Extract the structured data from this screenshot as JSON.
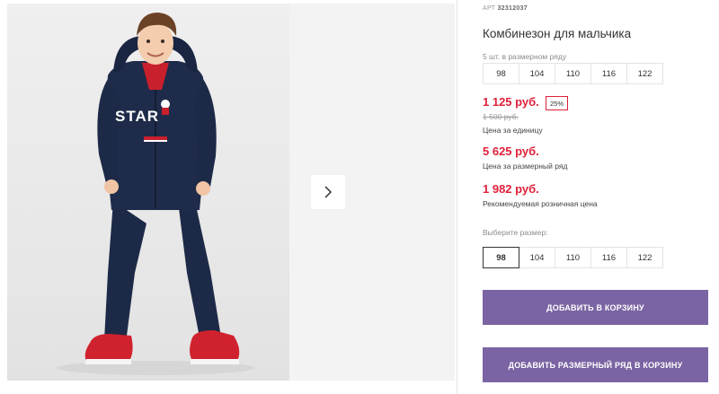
{
  "product": {
    "art_label": "АРТ",
    "art_number": "32312037",
    "title": "Комбинезон для мальчика",
    "pack_hint": "5 шт. в размерном ряду",
    "pack_sizes": [
      "98",
      "104",
      "110",
      "116",
      "122"
    ],
    "price_unit": "1 125 руб.",
    "discount_badge": "25%",
    "old_price": "1 500 руб.",
    "price_unit_caption": "Цена за единицу",
    "price_pack": "5 625 руб.",
    "price_pack_caption": "Цена за размерный ряд",
    "price_retail": "1 982 руб.",
    "price_retail_caption": "Рекомендуемая розничная цена",
    "choose_size_label": "Выберите размер:",
    "selectable_sizes": [
      "98",
      "104",
      "110",
      "116",
      "122"
    ],
    "selected_size": "98",
    "add_to_cart_label": "ДОБАВИТЬ В КОРЗИНУ",
    "add_pack_label": "ДОБАВИТЬ РАЗМЕРНЫЙ РЯД В КОРЗИНУ"
  },
  "gallery": {
    "shirt_print": "STAR",
    "next_icon": "chevron-right-icon"
  },
  "colors": {
    "accent_button": "#7b64a3",
    "price_red": "#e0203a"
  }
}
